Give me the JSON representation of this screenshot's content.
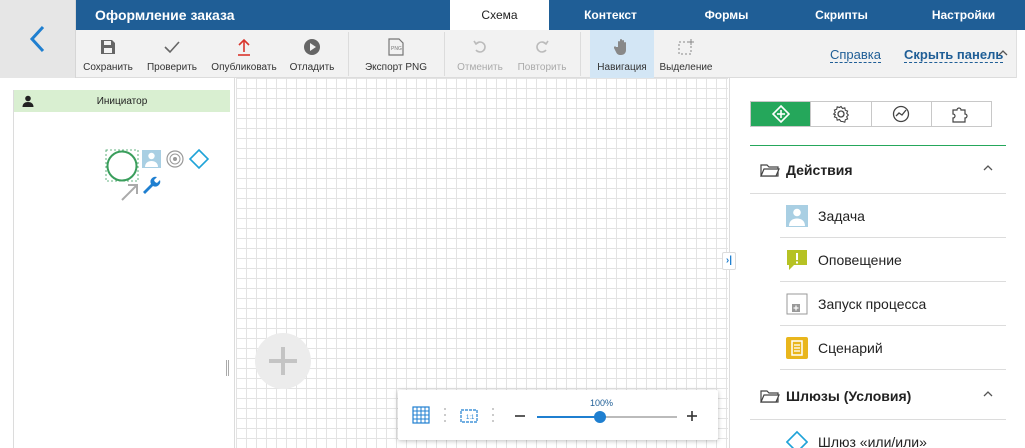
{
  "header": {
    "title": "Оформление заказа",
    "tabs": [
      {
        "label": "Схема",
        "active": true
      },
      {
        "label": "Контекст",
        "active": false
      },
      {
        "label": "Формы",
        "active": false
      },
      {
        "label": "Скрипты",
        "active": false
      },
      {
        "label": "Настройки",
        "active": false
      }
    ],
    "accent": "#1f5e96"
  },
  "toolbar": {
    "save": "Сохранить",
    "check": "Проверить",
    "publish": "Опубликовать",
    "debug": "Отладить",
    "export_png": "Экспорт PNG",
    "undo": "Отменить",
    "redo": "Повторить",
    "navigation": "Навигация",
    "selection": "Выделение",
    "help": "Справка",
    "hide_panel": "Скрыть панель"
  },
  "lane": {
    "title": "Инициатор"
  },
  "zoom": {
    "level": "100%",
    "fraction": 0.45
  },
  "right_panel": {
    "tabs": [
      "elements-icon",
      "settings-icon",
      "chart-icon",
      "puzzle-icon"
    ],
    "sections": [
      {
        "title": "Действия",
        "items": [
          {
            "label": "Задача",
            "icon": "user-task-icon"
          },
          {
            "label": "Оповещение",
            "icon": "notification-icon"
          },
          {
            "label": "Запуск процесса",
            "icon": "subprocess-icon"
          },
          {
            "label": "Сценарий",
            "icon": "script-icon"
          }
        ]
      },
      {
        "title": "Шлюзы (Условия)",
        "items": [
          {
            "label": "Шлюз «или/или»",
            "icon": "gateway-icon"
          }
        ]
      }
    ],
    "active_color": "#25a75b"
  }
}
